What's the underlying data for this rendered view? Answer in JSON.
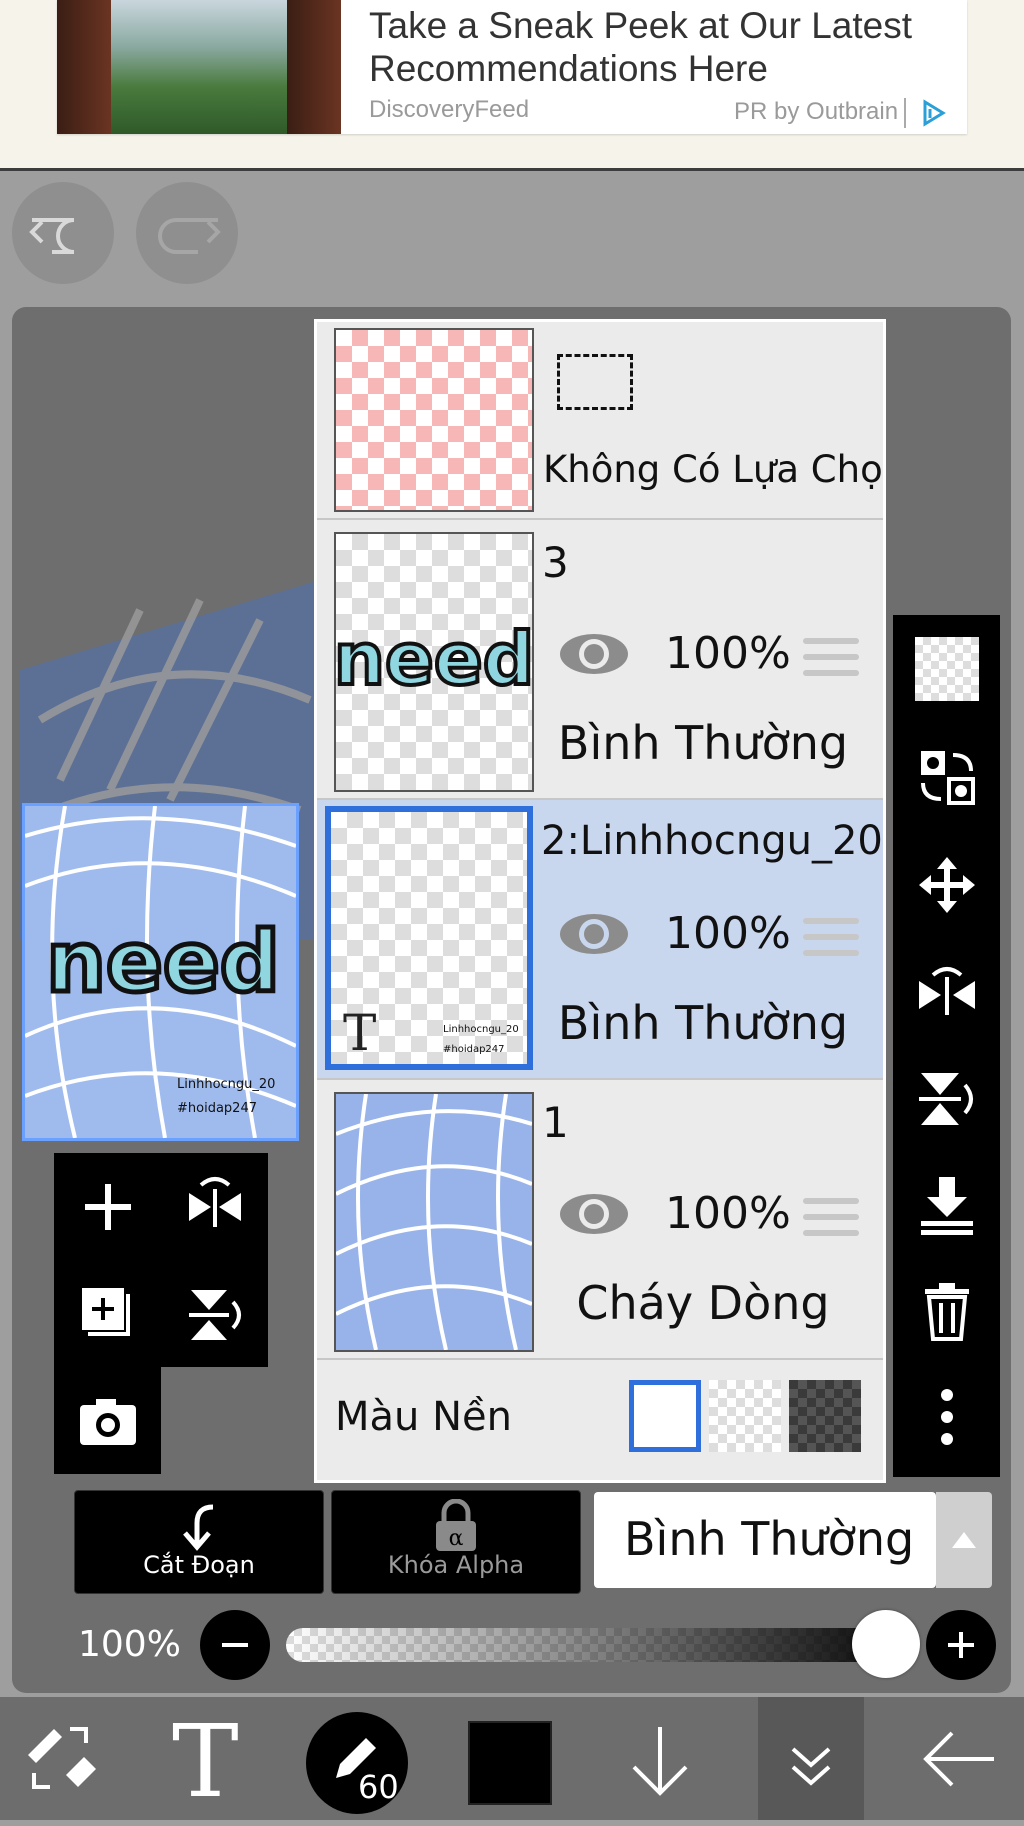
{
  "ad": {
    "title": "Take a Sneak Peek at Our Latest Recommendations Here",
    "source": "DiscoveryFeed",
    "pr_label": "PR by Outbrain"
  },
  "layers": {
    "selection": {
      "label": "Không Có Lựa Chọn"
    },
    "items": [
      {
        "name": "3",
        "opacity": "100%",
        "blend": "Bình Thường",
        "selected": false
      },
      {
        "name": "2:Linhhocngu_20",
        "opacity": "100%",
        "blend": "Bình Thường",
        "selected": true
      },
      {
        "name": "1",
        "opacity": "100%",
        "blend": "Cháy Dòng",
        "selected": false
      }
    ],
    "background": {
      "label": "Màu Nền"
    }
  },
  "artwork": {
    "word": "need",
    "watermark_line1": "Linhhocngu_20",
    "watermark_line2": "#hoidap247"
  },
  "controls": {
    "clip_label": "Cắt Đoạn",
    "alpha_lock_label": "Khóa Alpha",
    "blend_mode": "Bình Thường",
    "opacity_label": "100%",
    "opacity_value": 1.0
  },
  "bottom_toolbar": {
    "brush_size": "60",
    "text_tool_glyph": "T",
    "active_color": "#000000"
  },
  "colors": {
    "selected_layer": "#c9d7ee",
    "accent": "#2f6fdc"
  }
}
